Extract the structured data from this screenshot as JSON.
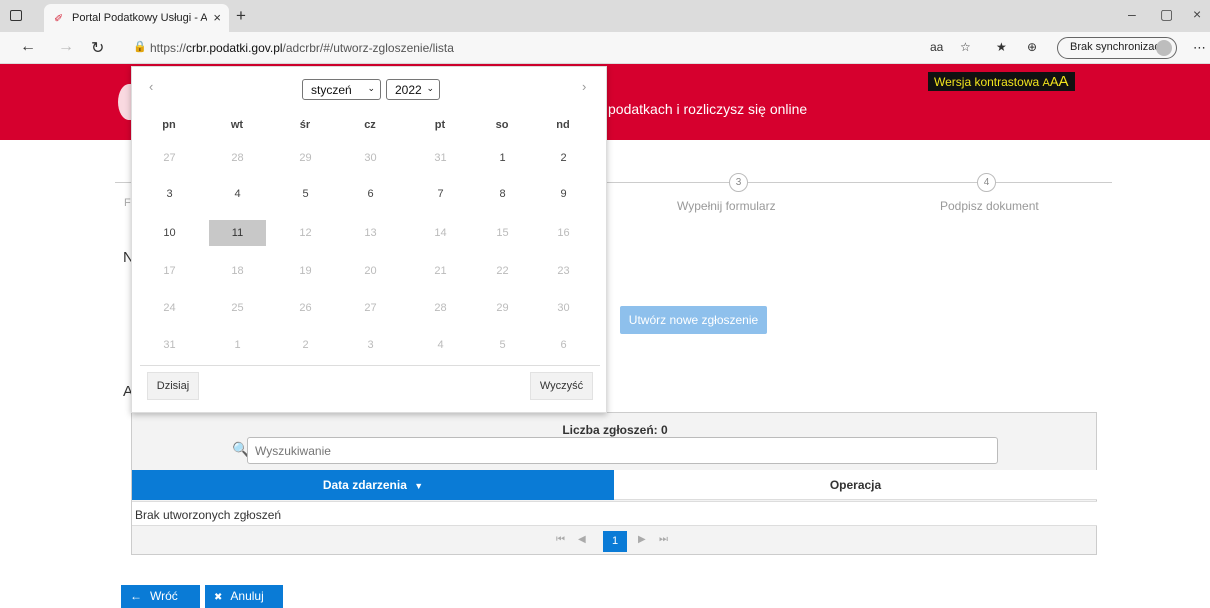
{
  "browser": {
    "tab_favicon": "✐",
    "tab_title": "Portal Podatkowy Usługi - ADCR",
    "tab_close": "×",
    "new_tab": "+",
    "window_controls": {
      "minimize": "–",
      "maximize": "▢",
      "close": "×"
    },
    "back": "←",
    "forward": "→",
    "reload": "↻",
    "lock": "🔒",
    "url_prefix": "https://",
    "url_host": "crbr.podatki.gov.pl",
    "url_path": "/adcrbr/#/utworz-zgloszenie/lista",
    "toolbar_icons": {
      "read_aloud": "aа",
      "favorite_add": "☆",
      "favorites": "★",
      "collections": "⊕"
    },
    "sync_label": "Brak synchronizacji",
    "more": "⋯"
  },
  "header": {
    "tagline": "podatkach i rozliczysz się online",
    "contrast_label": "Wersja kontrastowa",
    "font_sizes": [
      "A",
      "A",
      "A"
    ],
    "bg_color": "#d6002e"
  },
  "stepper": {
    "steps": [
      {
        "number": "3",
        "label": "Wypełnij formularz"
      },
      {
        "number": "4",
        "label": "Podpisz dokument"
      }
    ],
    "peek_letters": [
      "F",
      "N",
      "A"
    ]
  },
  "create_button": "Utwórz nowe zgłoszenie",
  "calendar": {
    "prev": "‹",
    "next": "›",
    "month": "styczeń",
    "year": "2022",
    "select_arrow": "⌄",
    "weekdays": [
      "pn",
      "wt",
      "śr",
      "cz",
      "pt",
      "so",
      "nd"
    ],
    "weeks": [
      [
        "27",
        "28",
        "29",
        "30",
        "31",
        "1",
        "2"
      ],
      [
        "3",
        "4",
        "5",
        "6",
        "7",
        "8",
        "9"
      ],
      [
        "10",
        "11",
        "12",
        "13",
        "14",
        "15",
        "16"
      ],
      [
        "17",
        "18",
        "19",
        "20",
        "21",
        "22",
        "23"
      ],
      [
        "24",
        "25",
        "26",
        "27",
        "28",
        "29",
        "30"
      ],
      [
        "31",
        "1",
        "2",
        "3",
        "4",
        "5",
        "6"
      ]
    ],
    "today_button": "Dzisiaj",
    "clear_button": "Wyczyść"
  },
  "table": {
    "count_label": "Liczba zgłoszeń: 0",
    "search_icon": "🔍",
    "search_placeholder": "Wyszukiwanie",
    "col_date": "Data zdarzenia",
    "sort_arrow": "▼",
    "col_operation": "Operacja",
    "empty_message": "Brak utworzonych zgłoszeń",
    "pagination": {
      "first": "⏮",
      "prev": "◀",
      "current": "1",
      "next": "▶",
      "last": "⏭"
    }
  },
  "footer": {
    "back_icon": "←",
    "back_label": "Wróć",
    "cancel_icon": "✖",
    "cancel_label": "Anuluj"
  }
}
